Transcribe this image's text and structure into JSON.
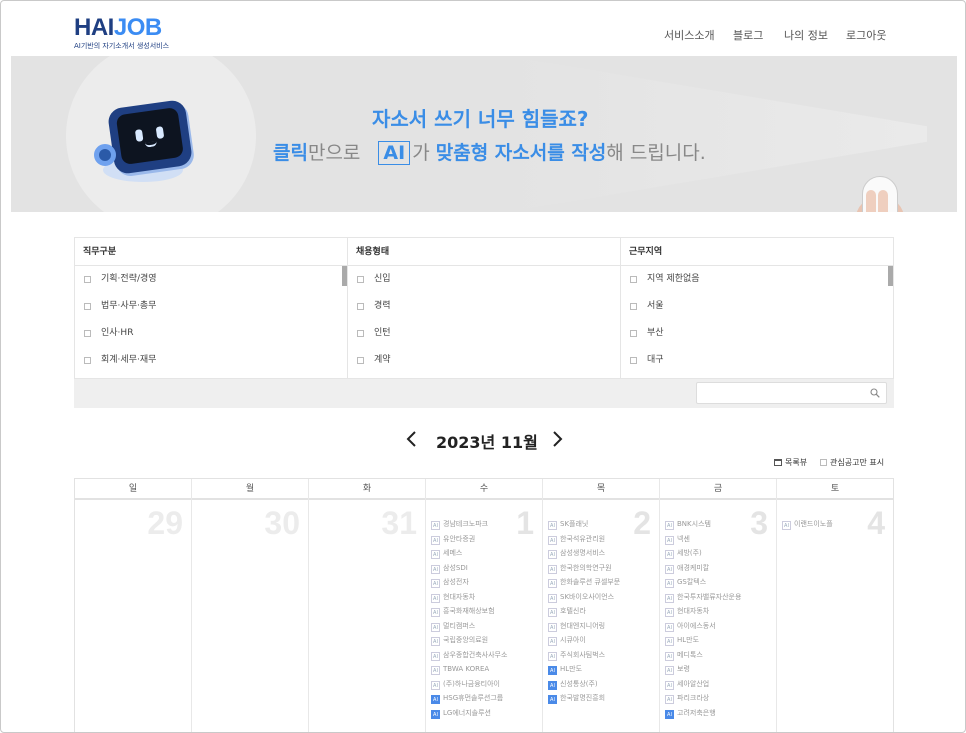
{
  "header": {
    "logo_hai": "HAI",
    "logo_job": "JOB",
    "logo_sub": "AI기반의 자기소개서 생성서비스",
    "nav": [
      "서비스소개",
      "블로그",
      "나의 정보",
      "로그아웃"
    ]
  },
  "banner": {
    "title": "자소서 쓰기 너무 힘들죠?",
    "sub_click": "클릭",
    "sub_only": "만으로",
    "sub_ai": "AI",
    "sub_ga": "가",
    "sub_custom": "맞춤형 자소서를 작성",
    "sub_end": "해 드립니다."
  },
  "filters": {
    "job": {
      "title": "직무구분",
      "items": [
        "기획·전략/경영",
        "법무·사무·총무",
        "인사·HR",
        "회계·세무·재무"
      ]
    },
    "type": {
      "title": "채용형태",
      "items": [
        "신입",
        "경력",
        "인턴",
        "계약"
      ]
    },
    "region": {
      "title": "근무지역",
      "items": [
        "지역 제한없음",
        "서울",
        "부산",
        "대구"
      ]
    },
    "search_placeholder": ""
  },
  "calendar": {
    "month_label": "2023년 11월",
    "list_view": "목록뷰",
    "interest_only": "관심공고만 표시",
    "weekdays": [
      "일",
      "월",
      "화",
      "수",
      "목",
      "금",
      "토"
    ],
    "days": [
      "29",
      "30",
      "31",
      "1",
      "2",
      "3",
      "4"
    ],
    "wed_events": [
      {
        "tag": "AI",
        "on": false,
        "name": "경남테크노파크"
      },
      {
        "tag": "AI",
        "on": false,
        "name": "유안타증권"
      },
      {
        "tag": "AI",
        "on": false,
        "name": "세메스"
      },
      {
        "tag": "AI",
        "on": false,
        "name": "삼성SDI"
      },
      {
        "tag": "AI",
        "on": false,
        "name": "삼성전자"
      },
      {
        "tag": "AI",
        "on": false,
        "name": "현대자동차"
      },
      {
        "tag": "AI",
        "on": false,
        "name": "흥국화재해상보험"
      },
      {
        "tag": "AI",
        "on": false,
        "name": "멀티캠퍼스"
      },
      {
        "tag": "AI",
        "on": false,
        "name": "국립중앙의료원"
      },
      {
        "tag": "AI",
        "on": false,
        "name": "삼우종합건축사사무소"
      },
      {
        "tag": "AI",
        "on": false,
        "name": "TBWA KOREA"
      },
      {
        "tag": "AI",
        "on": false,
        "name": "(주)하나금융티아이"
      },
      {
        "tag": "AI",
        "on": true,
        "name": "HSG휴먼솔루션그룹"
      },
      {
        "tag": "AI",
        "on": true,
        "name": "LG에너지솔루션"
      }
    ],
    "thu_events": [
      {
        "tag": "AI",
        "on": false,
        "name": "SK플래닛"
      },
      {
        "tag": "AI",
        "on": false,
        "name": "한국석유관리원"
      },
      {
        "tag": "AI",
        "on": false,
        "name": "삼성생명서비스"
      },
      {
        "tag": "AI",
        "on": false,
        "name": "한국한의학연구원"
      },
      {
        "tag": "AI",
        "on": false,
        "name": "한화솔루션 큐셀부문"
      },
      {
        "tag": "AI",
        "on": false,
        "name": "SK바이오사이언스"
      },
      {
        "tag": "AI",
        "on": false,
        "name": "호텔신라"
      },
      {
        "tag": "AI",
        "on": false,
        "name": "현대엔지니어링"
      },
      {
        "tag": "AI",
        "on": false,
        "name": "시큐아이"
      },
      {
        "tag": "AI",
        "on": false,
        "name": "주식회사팀벅스"
      },
      {
        "tag": "AI",
        "on": true,
        "name": "HL만도"
      },
      {
        "tag": "AI",
        "on": true,
        "name": "신성통상(주)"
      },
      {
        "tag": "AI",
        "on": true,
        "name": "한국발명진흥회"
      }
    ],
    "fri_events": [
      {
        "tag": "AI",
        "on": false,
        "name": "BNK시스템"
      },
      {
        "tag": "AI",
        "on": false,
        "name": "넥센"
      },
      {
        "tag": "AI",
        "on": false,
        "name": "세방(주)"
      },
      {
        "tag": "AI",
        "on": false,
        "name": "애경케미칼"
      },
      {
        "tag": "AI",
        "on": false,
        "name": "GS칼텍스"
      },
      {
        "tag": "AI",
        "on": false,
        "name": "한국투자밸류자산운용"
      },
      {
        "tag": "AI",
        "on": false,
        "name": "현대자동차"
      },
      {
        "tag": "AI",
        "on": false,
        "name": "아이에스동서"
      },
      {
        "tag": "AI",
        "on": false,
        "name": "HL만도"
      },
      {
        "tag": "AI",
        "on": false,
        "name": "메디톡스"
      },
      {
        "tag": "AI",
        "on": false,
        "name": "보령"
      },
      {
        "tag": "AI",
        "on": false,
        "name": "세아알산업"
      },
      {
        "tag": "AI",
        "on": false,
        "name": "파리크라상"
      },
      {
        "tag": "AI",
        "on": true,
        "name": "고려저축은행"
      }
    ],
    "sat_events": [
      {
        "tag": "AI",
        "on": false,
        "name": "이랜드이노플"
      }
    ]
  },
  "colors": {
    "accent": "#3a8de6",
    "navy": "#1f3f82",
    "tag_on": "#4a8ae8"
  }
}
